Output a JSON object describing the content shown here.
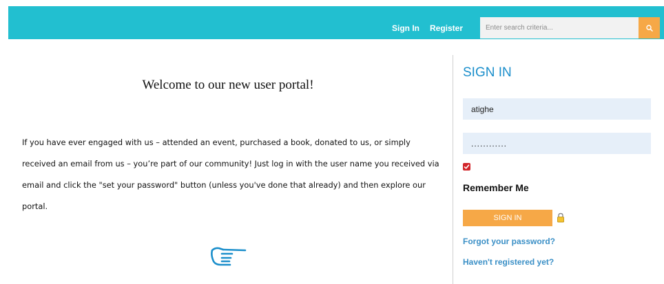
{
  "header": {
    "sign_in_label": "Sign In",
    "register_label": "Register",
    "search_placeholder": "Enter search criteria...",
    "search_icon": "search-icon",
    "bar_color": "#22bfd0",
    "accent_color": "#f6a847"
  },
  "main": {
    "welcome_heading": "Welcome to our new user portal!",
    "intro_text": "If you have ever engaged with us – attended an event, purchased a book, donated to us, or simply received an email from us – you’re part of our community! Just log in with the user name you received via email and click the \"set your password\" button (unless you've done that already) and then explore our portal.",
    "pointer_icon": "pointing-hand-icon"
  },
  "login": {
    "title": "SIGN IN",
    "username_value": "atighe",
    "password_value": "............",
    "remember_checked": true,
    "remember_label": "Remember Me",
    "submit_label": "SIGN IN",
    "lock_icon": "lock-icon",
    "forgot_password_label": "Forgot your password?",
    "register_link_label": "Haven't registered yet?",
    "title_color": "#1a8ecb",
    "link_color": "#3a8fc6"
  }
}
